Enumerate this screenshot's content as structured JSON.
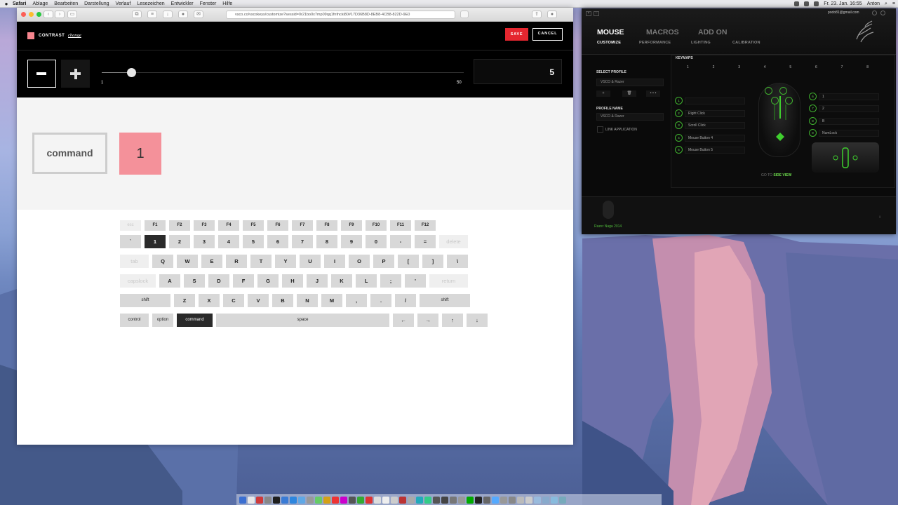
{
  "menubar": {
    "items": [
      "Safari",
      "Ablage",
      "Bearbeiten",
      "Darstellung",
      "Verlauf",
      "Lesezeichen",
      "Entwickler",
      "Fenster",
      "Hilfe"
    ],
    "clock": "Fr. 23. Jan.  16:55",
    "user": "Anton"
  },
  "browser": {
    "url": "vsco.co/vscokeys/customize?sessid=0r21bo0x7mp09qq1fnfncki80#17D36B8D-8EB8-4CB8-822D-9E0"
  },
  "editor": {
    "contrast_label": "CONTRAST",
    "change_link": "change",
    "save_label": "SAVE",
    "cancel_label": "CANCEL",
    "swatch_color": "#f7868f",
    "slider": {
      "min_label": "1",
      "max_label": "50",
      "min": 1,
      "max": 50,
      "value": 5
    },
    "value_display": "5",
    "preview_key": "command",
    "preview_value": "1"
  },
  "keyboard": {
    "rows": [
      {
        "fn": true,
        "keys": [
          [
            "esc",
            1,
            "dim"
          ],
          [
            "F1",
            1
          ],
          [
            "F2",
            1
          ],
          [
            "F3",
            1
          ],
          [
            "F4",
            1
          ],
          [
            "F5",
            1
          ],
          [
            "F6",
            1
          ],
          [
            "F7",
            1
          ],
          [
            "F8",
            1
          ],
          [
            "F9",
            1
          ],
          [
            "F10",
            1
          ],
          [
            "F11",
            1
          ],
          [
            "F12",
            1
          ]
        ]
      },
      {
        "keys": [
          [
            "`",
            1
          ],
          [
            "1",
            1,
            "active"
          ],
          [
            "2",
            1
          ],
          [
            "3",
            1
          ],
          [
            "4",
            1
          ],
          [
            "5",
            1
          ],
          [
            "6",
            1
          ],
          [
            "7",
            1
          ],
          [
            "8",
            1
          ],
          [
            "9",
            1
          ],
          [
            "0",
            1
          ],
          [
            "-",
            1
          ],
          [
            "=",
            1
          ],
          [
            "delete",
            1.3,
            "dim"
          ]
        ]
      },
      {
        "keys": [
          [
            "tab",
            1.3,
            "dim"
          ],
          [
            "Q",
            1
          ],
          [
            "W",
            1
          ],
          [
            "E",
            1
          ],
          [
            "R",
            1
          ],
          [
            "T",
            1
          ],
          [
            "Y",
            1
          ],
          [
            "U",
            1
          ],
          [
            "I",
            1
          ],
          [
            "O",
            1
          ],
          [
            "P",
            1
          ],
          [
            "[",
            1
          ],
          [
            "]",
            1
          ],
          [
            "\\",
            1
          ]
        ]
      },
      {
        "keys": [
          [
            "capslock",
            1.6,
            "dim"
          ],
          [
            "A",
            1
          ],
          [
            "S",
            1
          ],
          [
            "D",
            1
          ],
          [
            "F",
            1
          ],
          [
            "G",
            1
          ],
          [
            "H",
            1
          ],
          [
            "J",
            1
          ],
          [
            "K",
            1
          ],
          [
            "L",
            1
          ],
          [
            ";",
            1
          ],
          [
            "'",
            1
          ],
          [
            "return",
            1.7,
            "dim"
          ]
        ]
      },
      {
        "keys": [
          [
            "shift",
            2.2,
            "small"
          ],
          [
            "Z",
            1
          ],
          [
            "X",
            1
          ],
          [
            "C",
            1
          ],
          [
            "V",
            1
          ],
          [
            "B",
            1
          ],
          [
            "N",
            1
          ],
          [
            "M",
            1
          ],
          [
            ",",
            1
          ],
          [
            ".",
            1
          ],
          [
            "/",
            1
          ],
          [
            "shift",
            2.2,
            "small"
          ]
        ]
      },
      {
        "keys": [
          [
            "control",
            1.3,
            "small"
          ],
          [
            "option",
            1,
            "small"
          ],
          [
            "command",
            1.6,
            "active small"
          ],
          [
            "space",
            7.2,
            "small"
          ],
          [
            "←",
            1
          ],
          [
            "→",
            1
          ],
          [
            "↑",
            1
          ],
          [
            "↓",
            1
          ]
        ]
      }
    ]
  },
  "razer": {
    "email": "podo81@gmail.com",
    "tabs": [
      "MOUSE",
      "MACROS",
      "ADD ON"
    ],
    "subtabs": [
      "CUSTOMIZE",
      "PERFORMANCE",
      "LIGHTING",
      "CALIBRATION"
    ],
    "select_profile_label": "SELECT PROFILE",
    "profile_value": "VSCO & Razer",
    "profile_buttons": [
      "+",
      "🗑",
      "• • •"
    ],
    "profile_name_label": "PROFILE NAME",
    "profile_name_value": "VSCO & Razer",
    "link_application": "LINK APPLICATION",
    "keymaps_label": "KEYMAPS",
    "keymap_numbers": [
      "1",
      "2",
      "3",
      "4",
      "5",
      "6",
      "7",
      "8"
    ],
    "left_buttons": [
      {
        "n": "1",
        "label": ""
      },
      {
        "n": "2",
        "label": "Right Click"
      },
      {
        "n": "3",
        "label": "Scroll Click"
      },
      {
        "n": "4",
        "label": "Mouse Button 4"
      },
      {
        "n": "5",
        "label": "Mouse Button 5"
      }
    ],
    "right_buttons": [
      {
        "n": "6",
        "label": "1"
      },
      {
        "n": "7",
        "label": "2"
      },
      {
        "n": "8",
        "label": "B"
      },
      {
        "n": "9",
        "label": "NumLock"
      }
    ],
    "goto_prefix": "GO TO",
    "goto_link": "SIDE VIEW",
    "device_name": "Razer Naga 2014"
  }
}
